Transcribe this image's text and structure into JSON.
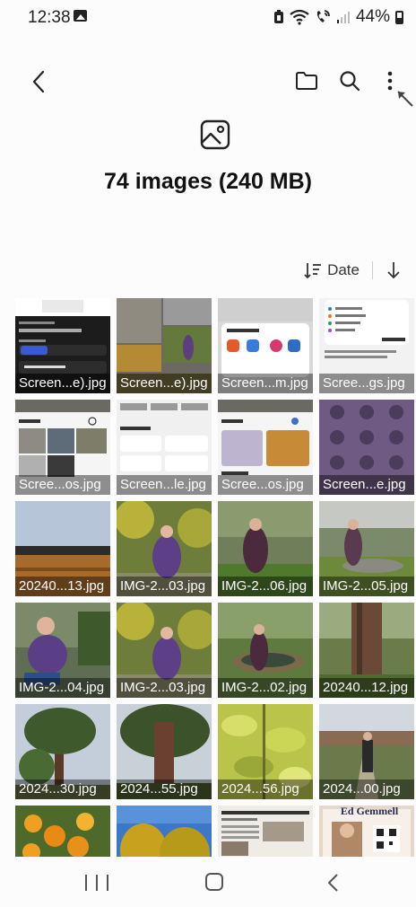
{
  "status_bar": {
    "time": "12:38",
    "battery_percent": "44%",
    "icons": [
      "gallery-icon",
      "battery-saver-icon",
      "wifi-icon",
      "wifi-calling-icon",
      "signal-icon",
      "battery-icon"
    ]
  },
  "toolbar": {
    "back_icon": "chevron-left-icon",
    "folder_icon": "folder-icon",
    "search_icon": "search-icon",
    "more_icon": "more-vert-icon"
  },
  "header": {
    "icon": "image-icon",
    "title": "74 images (240 MB)"
  },
  "sort": {
    "label": "Date",
    "direction": "descending"
  },
  "tiles": [
    {
      "caption": "Screen...e).jpg",
      "kind": "screenshot-dark"
    },
    {
      "caption": "Screen...e).jpg",
      "kind": "screenshot-grid"
    },
    {
      "caption": "Screen...m.jpg",
      "kind": "screenshot-openwith"
    },
    {
      "caption": "Scree...gs.jpg",
      "kind": "screenshot-storage"
    },
    {
      "caption": "Scree...os.jpg",
      "kind": "screenshot-today"
    },
    {
      "caption": "Screen...le.jpg",
      "kind": "screenshot-categories"
    },
    {
      "caption": "Scree...os.jpg",
      "kind": "screenshot-today2"
    },
    {
      "caption": "Screen...e.jpg",
      "kind": "screenshot-quicksettings"
    },
    {
      "caption": "20240...13.jpg",
      "kind": "photo-wood"
    },
    {
      "caption": "IMG-2...03.jpg",
      "kind": "photo-person-yellow"
    },
    {
      "caption": "IMG-2...06.jpg",
      "kind": "photo-person-lawn"
    },
    {
      "caption": "IMG-2...05.jpg",
      "kind": "photo-fountain"
    },
    {
      "caption": "IMG-2...04.jpg",
      "kind": "photo-crouch"
    },
    {
      "caption": "IMG-2...03.jpg",
      "kind": "photo-person-yellow"
    },
    {
      "caption": "IMG-2...02.jpg",
      "kind": "photo-pond"
    },
    {
      "caption": "20240...12.jpg",
      "kind": "photo-trunk"
    },
    {
      "caption": "2024...30.jpg",
      "kind": "photo-pine"
    },
    {
      "caption": "2024...55.jpg",
      "kind": "photo-redwood"
    },
    {
      "caption": "2024...56.jpg",
      "kind": "photo-leaves"
    },
    {
      "caption": "2024...00.jpg",
      "kind": "photo-man-garden"
    },
    {
      "caption": "",
      "kind": "photo-orange-flowers"
    },
    {
      "caption": "",
      "kind": "photo-yellow-bush"
    },
    {
      "caption": "",
      "kind": "photo-newspaper"
    },
    {
      "caption": "",
      "kind": "photo-poster"
    }
  ],
  "poster_text": "Ed Gemmell",
  "nav_bar": {
    "recents_icon": "recents-icon",
    "home_icon": "home-icon",
    "back_icon": "back-icon"
  }
}
